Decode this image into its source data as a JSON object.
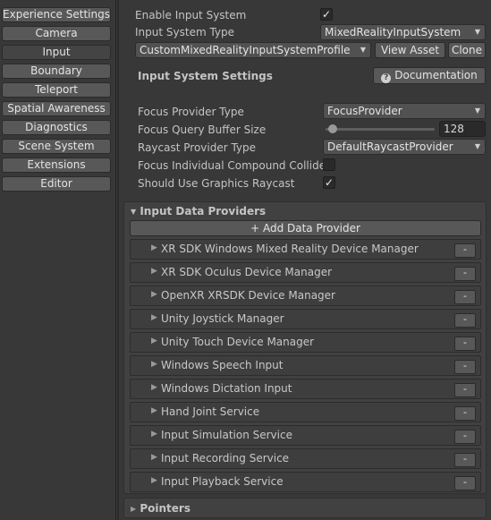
{
  "sidebar": {
    "items": [
      {
        "label": "Experience Settings"
      },
      {
        "label": "Camera"
      },
      {
        "label": "Input"
      },
      {
        "label": "Boundary"
      },
      {
        "label": "Teleport"
      },
      {
        "label": "Spatial Awareness"
      },
      {
        "label": "Diagnostics"
      },
      {
        "label": "Scene System"
      },
      {
        "label": "Extensions"
      },
      {
        "label": "Editor"
      }
    ],
    "active_item": "Input"
  },
  "main": {
    "enable_input_system": {
      "label": "Enable Input System",
      "checked": true
    },
    "input_system_type": {
      "label": "Input System Type",
      "value": "MixedRealityInputSystem"
    },
    "profile": {
      "value": "CustomMixedRealityInputSystemProfile",
      "view_asset_label": "View Asset",
      "clone_label": "Clone"
    },
    "settings_header": "Input System Settings",
    "documentation_label": "Documentation",
    "focus_provider_type": {
      "label": "Focus Provider Type",
      "value": "FocusProvider"
    },
    "focus_query_buffer_size": {
      "label": "Focus Query Buffer Size",
      "value": "128"
    },
    "raycast_provider_type": {
      "label": "Raycast Provider Type",
      "value": "DefaultRaycastProvider"
    },
    "focus_individual_compound_collider": {
      "label": "Focus Individual Compound Collider",
      "checked": false
    },
    "should_use_graphics_raycast": {
      "label": "Should Use Graphics Raycast",
      "checked": true
    },
    "input_data_providers": {
      "title": "Input Data Providers",
      "add_label": "+ Add Data Provider",
      "remove_label": "-",
      "providers": [
        {
          "name": "XR SDK Windows Mixed Reality Device Manager"
        },
        {
          "name": "XR SDK Oculus Device Manager"
        },
        {
          "name": "OpenXR XRSDK Device Manager"
        },
        {
          "name": "Unity Joystick Manager"
        },
        {
          "name": "Unity Touch Device Manager"
        },
        {
          "name": "Windows Speech Input"
        },
        {
          "name": "Windows Dictation Input"
        },
        {
          "name": "Hand Joint Service"
        },
        {
          "name": "Input Simulation Service"
        },
        {
          "name": "Input Recording Service"
        },
        {
          "name": "Input Playback Service"
        }
      ]
    },
    "pointers_title": "Pointers",
    "glyphs": {
      "check": "✓",
      "tri_down": "▼",
      "tri_right": "▶",
      "info": "?"
    }
  }
}
